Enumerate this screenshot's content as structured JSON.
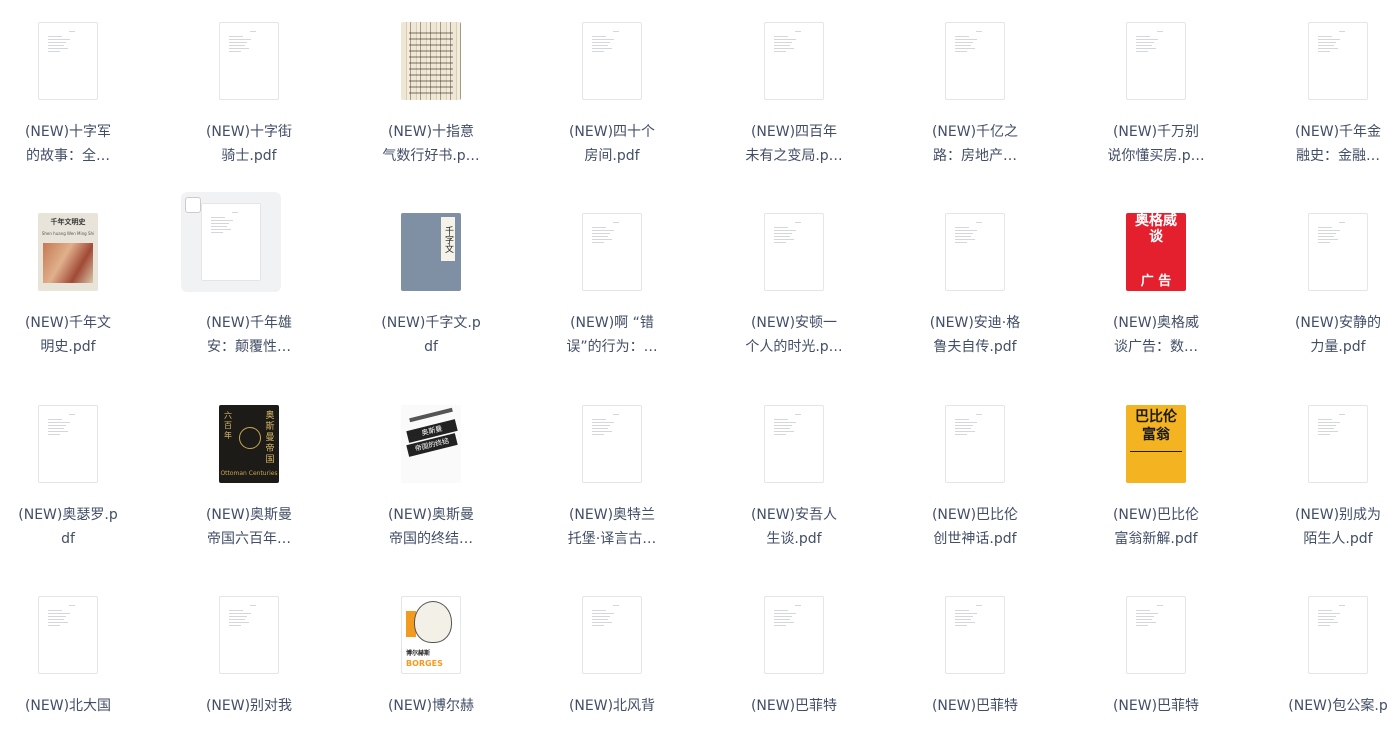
{
  "files": [
    {
      "label": "(NEW)十字军\n的故事：全…",
      "thumb": "doc"
    },
    {
      "label": "(NEW)十字街\n骑士.pdf",
      "thumb": "doc"
    },
    {
      "label": "(NEW)十指意\n气数行好书.p…",
      "thumb": "cover-calligraphy"
    },
    {
      "label": "(NEW)四十个\n房间.pdf",
      "thumb": "doc"
    },
    {
      "label": "(NEW)四百年\n未有之变局.p…",
      "thumb": "doc"
    },
    {
      "label": "(NEW)千亿之\n路：房地产…",
      "thumb": "doc"
    },
    {
      "label": "(NEW)千万别\n说你懂买房.p…",
      "thumb": "doc"
    },
    {
      "label": "(NEW)千年金\n融史：金融…",
      "thumb": "doc"
    },
    {
      "label": "(NEW)千年文\n明史.pdf",
      "thumb": "cover-civilization",
      "cover_text": [
        "千年文明史",
        "Shen huang Wen Ming Shi"
      ]
    },
    {
      "label": "(NEW)千年雄\n安：颠覆性…",
      "thumb": "doc",
      "selected": true
    },
    {
      "label": "(NEW)千字文.p\ndf",
      "thumb": "cover-qianziwen",
      "cover_text": [
        "千字文"
      ]
    },
    {
      "label": "(NEW)啊 “错\n误”的行为：…",
      "thumb": "doc"
    },
    {
      "label": "(NEW)安顿一\n个人的时光.p…",
      "thumb": "doc"
    },
    {
      "label": "(NEW)安迪·格\n鲁夫自传.pdf",
      "thumb": "doc"
    },
    {
      "label": "(NEW)奥格威\n谈广告：数…",
      "thumb": "cover-ogilvy",
      "cover_text": [
        "奥格威\n谈",
        "广 告"
      ]
    },
    {
      "label": "(NEW)安静的\n力量.pdf",
      "thumb": "doc"
    },
    {
      "label": "(NEW)奥瑟罗.p\ndf",
      "thumb": "doc"
    },
    {
      "label": "(NEW)奥斯曼\n帝国六百年…",
      "thumb": "cover-ottoman",
      "cover_text": [
        "奥斯曼帝国",
        "六百年",
        "Ottoman Centuries"
      ]
    },
    {
      "label": "(NEW)奥斯曼\n帝国的终结…",
      "thumb": "cover-end",
      "cover_text": [
        "奥斯曼",
        "帝国的终结"
      ]
    },
    {
      "label": "(NEW)奥特兰\n托堡·译言古…",
      "thumb": "doc"
    },
    {
      "label": "(NEW)安吾人\n生谈.pdf",
      "thumb": "doc"
    },
    {
      "label": "(NEW)巴比伦\n创世神话.pdf",
      "thumb": "doc"
    },
    {
      "label": "(NEW)巴比伦\n富翁新解.pdf",
      "thumb": "cover-babylon",
      "cover_text": [
        "巴比伦",
        "富翁"
      ]
    },
    {
      "label": "(NEW)别成为\n陌生人.pdf",
      "thumb": "doc"
    },
    {
      "label": "(NEW)北大国",
      "thumb": "doc"
    },
    {
      "label": "(NEW)别对我",
      "thumb": "doc"
    },
    {
      "label": "(NEW)博尔赫",
      "thumb": "cover-borges",
      "cover_text": [
        "博尔赫斯",
        "BORGES"
      ]
    },
    {
      "label": "(NEW)北风背",
      "thumb": "doc"
    },
    {
      "label": "(NEW)巴菲特",
      "thumb": "doc"
    },
    {
      "label": "(NEW)巴菲特",
      "thumb": "doc"
    },
    {
      "label": "(NEW)巴菲特",
      "thumb": "doc"
    },
    {
      "label": "(NEW)包公案.p",
      "thumb": "doc"
    }
  ]
}
